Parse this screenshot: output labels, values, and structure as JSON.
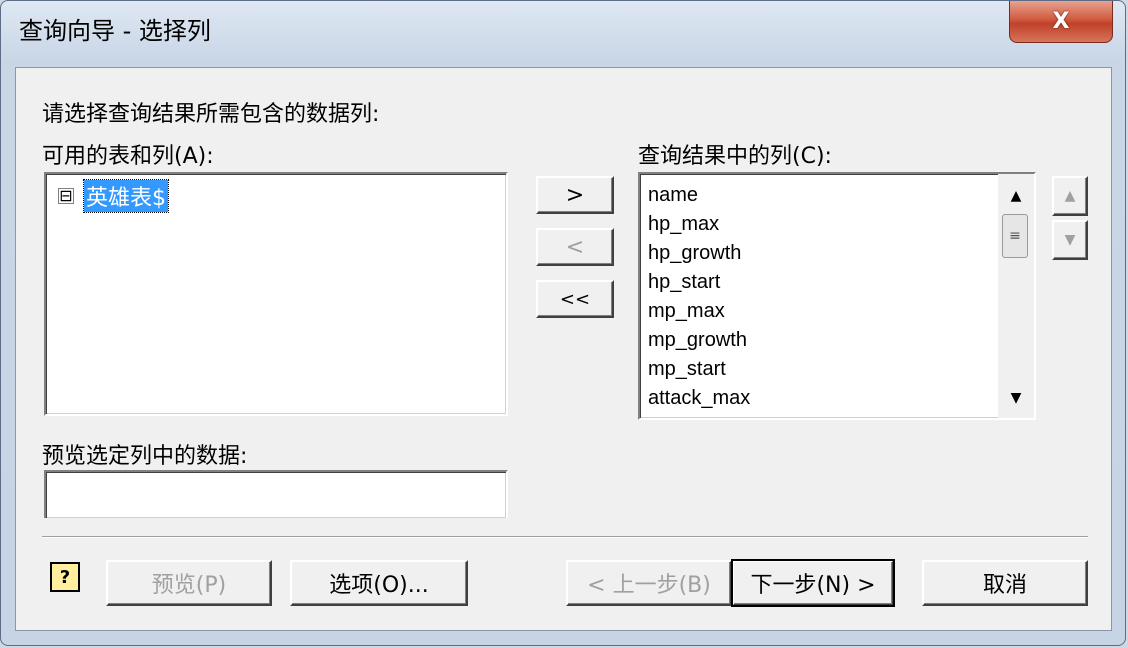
{
  "window": {
    "title": "查询向导 - 选择列",
    "close_glyph": "X"
  },
  "prompt": "请选择查询结果所需包含的数据列:",
  "available": {
    "label": "可用的表和列(A):",
    "toggle_glyph": "⊟",
    "table_name": "英雄表$"
  },
  "transfer_buttons": {
    "add": ">",
    "remove": "<",
    "remove_all": "<<"
  },
  "selected": {
    "label": "查询结果中的列(C):",
    "columns": [
      "name",
      "hp_max",
      "hp_growth",
      "hp_start",
      "mp_max",
      "mp_growth",
      "mp_start",
      "attack_max"
    ],
    "scroll_up": "▲",
    "scroll_down": "▼",
    "thumb_grip": "≡"
  },
  "move": {
    "up": "▲",
    "down": "▼"
  },
  "preview": {
    "label": "预览选定列中的数据:",
    "value": ""
  },
  "footer": {
    "help": "?",
    "preview_button": "预览(P)",
    "options_button": "选项(O)...",
    "back_button": "< 上一步(B)",
    "next_button": "下一步(N) >",
    "cancel_button": "取消"
  },
  "colors": {
    "selection": "#3399ff",
    "close": "#c0412a"
  }
}
